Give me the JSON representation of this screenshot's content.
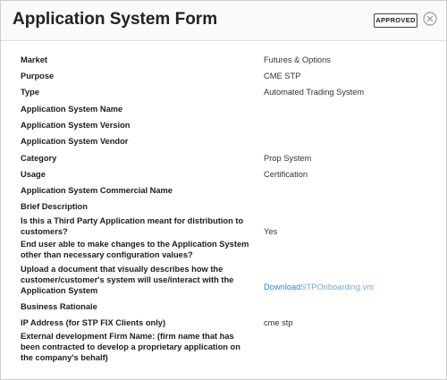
{
  "header": {
    "title": "Application System Form",
    "badge": "APPROVED",
    "close_icon": "close-circle-icon"
  },
  "fields": [
    {
      "label": "Market",
      "value": "Futures & Options"
    },
    {
      "label": "Purpose",
      "value": "CME STP"
    },
    {
      "label": "Type",
      "value": "Automated Trading System"
    },
    {
      "label": "Application System Name",
      "value": ""
    },
    {
      "label": "Application System Version",
      "value": ""
    },
    {
      "label": "Application System Vendor",
      "value": ""
    },
    {
      "label": "Category",
      "value": "Prop System"
    },
    {
      "label": "Usage",
      "value": "Certification"
    },
    {
      "label": "Application System Commercial Name",
      "value": ""
    },
    {
      "label": "Brief Description",
      "value": ""
    },
    {
      "label": "Is this a Third Party Application meant for distribution to customers?",
      "value": "Yes"
    },
    {
      "label": "End user able to make changes to the Application System other than necessary configuration values?",
      "value": ""
    },
    {
      "label": "Upload a document that visually describes how the customer/customer's system will use/interact with the Application System",
      "value": "",
      "link": {
        "part1": "Download",
        "part2": "STPOnboarding.vm"
      }
    },
    {
      "label": "Business Rationale",
      "value": ""
    },
    {
      "label": "IP Address (for STP FIX Clients only)",
      "value": "cme stp"
    },
    {
      "label": "External development Firm Name: (firm name that has been contracted to develop a proprietary application on the company's behalf)",
      "value": ""
    }
  ],
  "colors": {
    "link_primary": "#2a86d1",
    "link_secondary": "#7aa9cf"
  }
}
